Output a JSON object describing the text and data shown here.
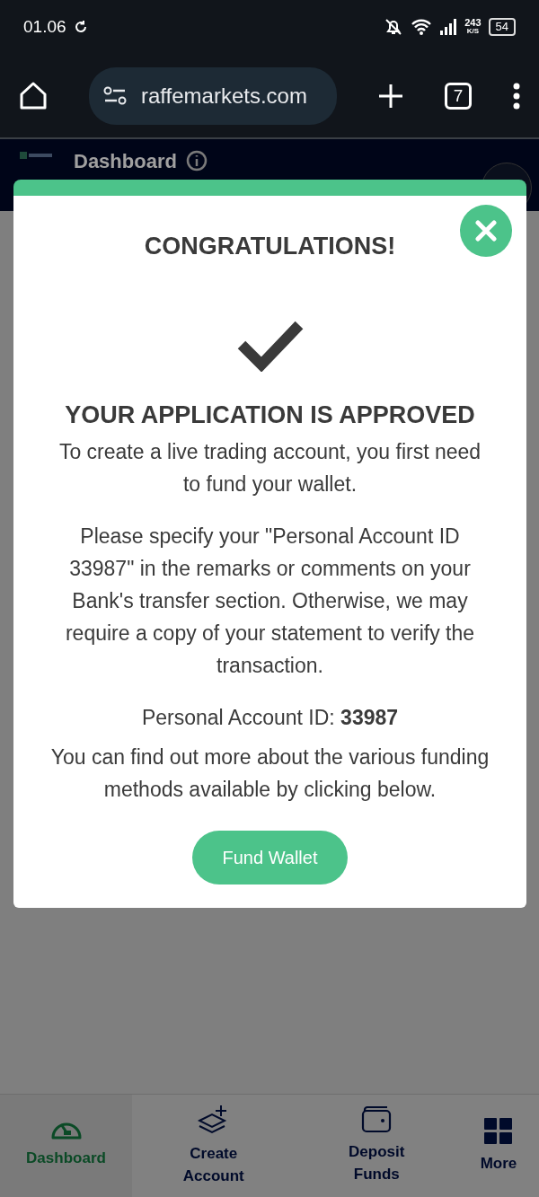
{
  "status_bar": {
    "time": "01.06",
    "network_speed": "243",
    "speed_unit": "K/S",
    "battery": "54"
  },
  "browser": {
    "url": "raffemarkets.com",
    "tab_count": "7"
  },
  "header": {
    "title": "Dashboard"
  },
  "modal": {
    "title": "CONGRATULATIONS!",
    "heading": "YOUR APPLICATION IS APPROVED",
    "paragraphs": [
      "To create a live trading account, you first need to fund your wallet.",
      "Please specify your \"Personal Account ID 33987\" in the remarks or comments on your Bank's transfer section. Otherwise, we may require a copy of your statement to verify the transaction.",
      "Personal Account ID: **33987**",
      "You can find out more about the various funding methods available by clicking below."
    ],
    "button": "Fund Wallet"
  },
  "bottom_nav": [
    {
      "kind": "gauge",
      "label": "Dashboard",
      "selected": true
    },
    {
      "kind": "layers",
      "label": "Create Account",
      "selected": false
    },
    {
      "kind": "wallet",
      "label": "Deposit Funds",
      "selected": false
    },
    {
      "kind": "grid",
      "label": "More",
      "selected": false
    }
  ]
}
